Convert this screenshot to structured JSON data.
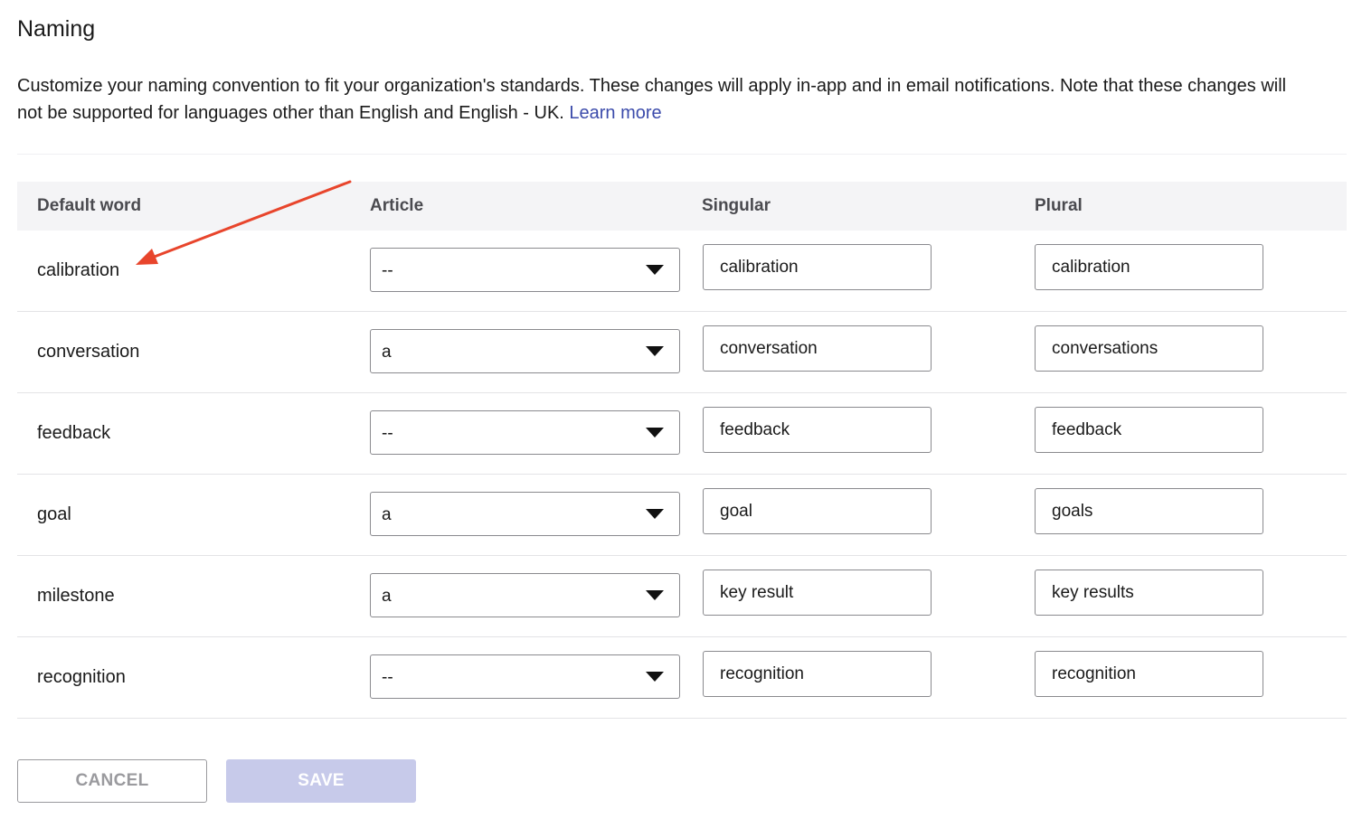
{
  "header": {
    "title": "Naming",
    "description": "Customize your naming convention to fit your organization's standards. These changes will apply in-app and in email notifications. Note that these changes will not be supported for languages other than English and English - UK.",
    "learn_more": "Learn more"
  },
  "table": {
    "columns": [
      "Default word",
      "Article",
      "Singular",
      "Plural"
    ],
    "rows": [
      {
        "word": "calibration",
        "article": "--",
        "singular": "calibration",
        "plural": "calibration"
      },
      {
        "word": "conversation",
        "article": "a",
        "singular": "conversation",
        "plural": "conversations"
      },
      {
        "word": "feedback",
        "article": "--",
        "singular": "feedback",
        "plural": "feedback"
      },
      {
        "word": "goal",
        "article": "a",
        "singular": "goal",
        "plural": "goals"
      },
      {
        "word": "milestone",
        "article": "a",
        "singular": "key result",
        "plural": "key results"
      },
      {
        "word": "recognition",
        "article": "--",
        "singular": "recognition",
        "plural": "recognition"
      }
    ]
  },
  "actions": {
    "cancel_label": "CANCEL",
    "save_label": "SAVE"
  },
  "colors": {
    "accent_link": "#3b4bab",
    "save_disabled": "#c7caea",
    "annotation_arrow": "#e8452c"
  }
}
